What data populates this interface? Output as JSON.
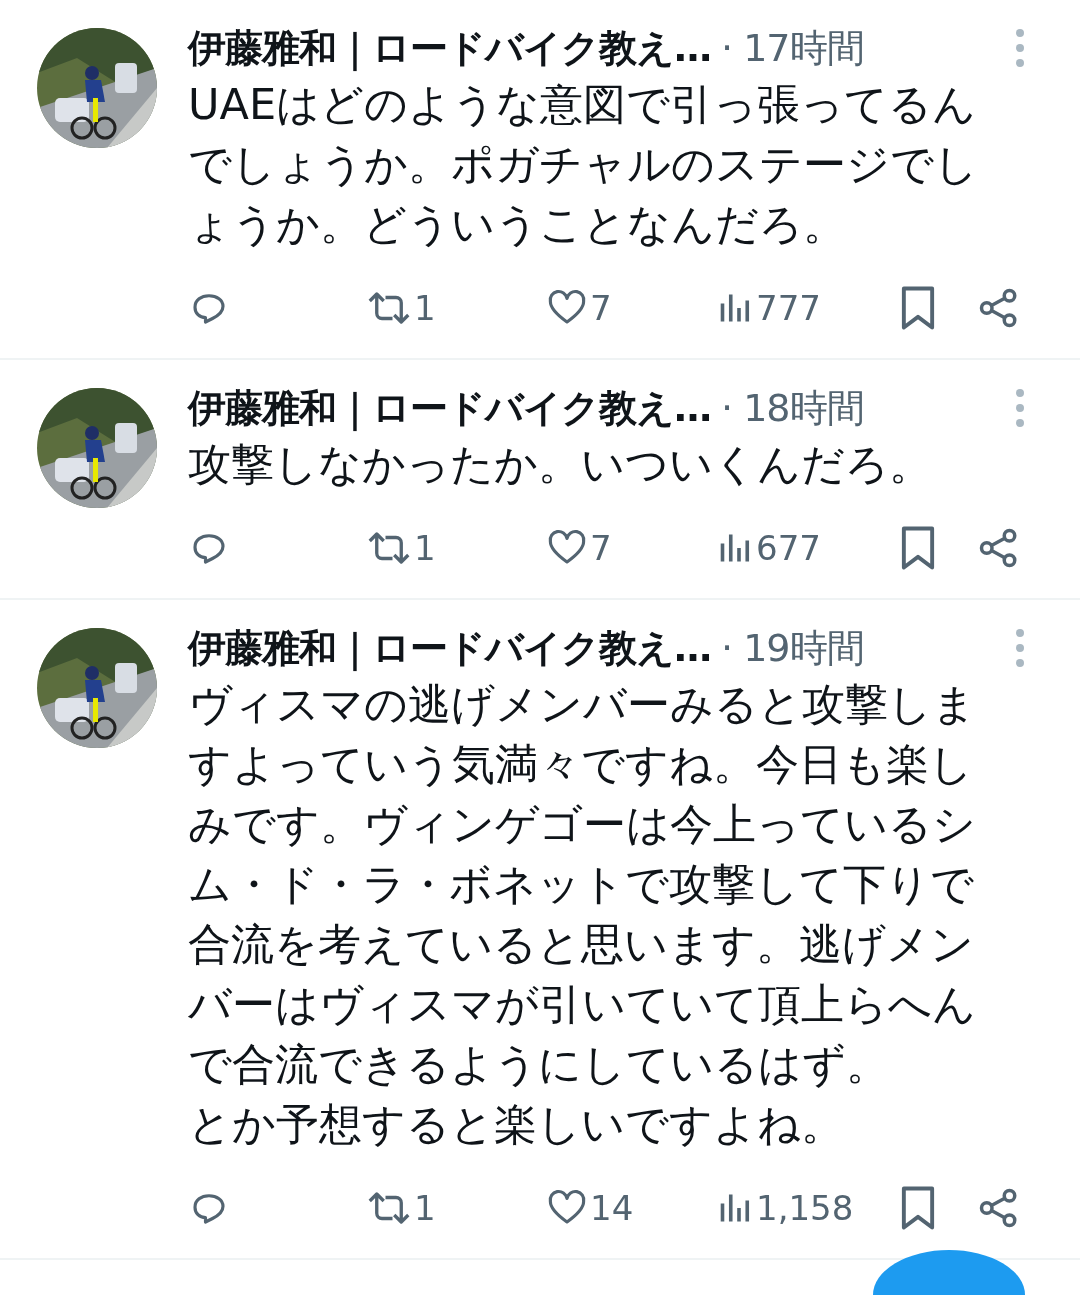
{
  "tweets": [
    {
      "name": "伊藤雅和｜ロードバイク教え…",
      "time": "· 17時間",
      "text": "UAEはどのような意図で引っ張ってるんでしょうか。ポガチャルのステージでしょうか。どういうことなんだろ。",
      "retweets": "1",
      "likes": "7",
      "views": "777"
    },
    {
      "name": "伊藤雅和｜ロードバイク教え…",
      "time": "· 18時間",
      "text": "攻撃しなかったか。いついくんだろ。",
      "retweets": "1",
      "likes": "7",
      "views": "677"
    },
    {
      "name": "伊藤雅和｜ロードバイク教え…",
      "time": "· 19時間",
      "text": "ヴィスマの逃げメンバーみると攻撃しますよっていう気満々ですね。今日も楽しみです。ヴィンゲゴーは今上っているシム・ド・ラ・ボネットで攻撃して下りで合流を考えていると思います。逃げメンバーはヴィスマが引いていて頂上らへんで合流できるようにしているはず。",
      "text_2": "とか予想すると楽しいですよね。",
      "retweets": "1",
      "likes": "14",
      "views": "1,158"
    }
  ]
}
